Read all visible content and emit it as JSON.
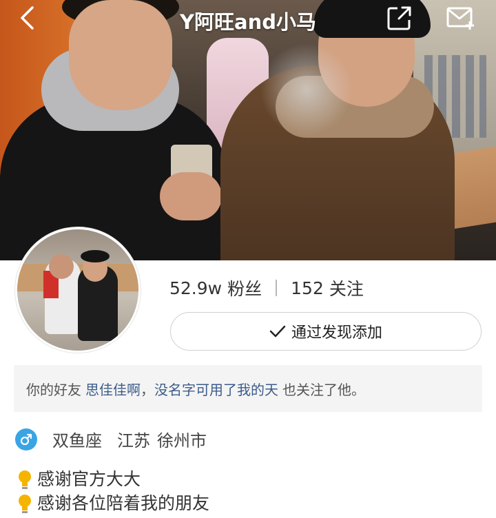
{
  "header": {
    "title": "Y阿旺and小马",
    "icons": [
      "back-icon",
      "share-icon",
      "mail-add-icon"
    ]
  },
  "profile": {
    "followers_count": "52.9w",
    "followers_label": "粉丝",
    "following_count": "152",
    "following_label": "关注",
    "add_button_label": "通过发现添加",
    "friend_notice": {
      "prefix": "你的好友",
      "friend1": "思佳佳啊",
      "sep": "，",
      "friend2": "没名字可用了我的天",
      "suffix": "也关注了他。"
    },
    "gender_icon": "male-icon",
    "zodiac": "双鱼座",
    "province": "江苏",
    "city": "徐州市",
    "bio": [
      "感谢官方大大",
      "感谢各位陪着我的朋友"
    ]
  },
  "colors": {
    "accent_blue": "#3aa4e4",
    "link": "#3b5b8a",
    "bulb": "#f4b400"
  }
}
